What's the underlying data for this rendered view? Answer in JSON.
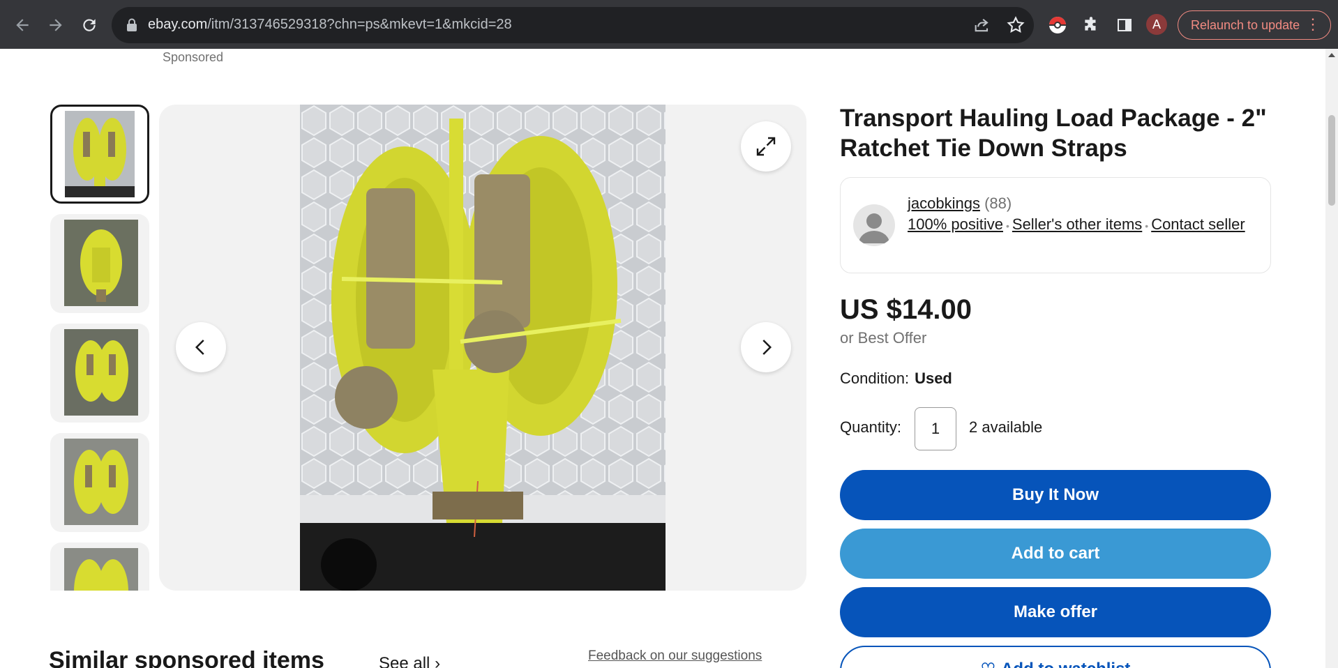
{
  "browser": {
    "url_host": "ebay.com",
    "url_path": "/itm/313746529318?chn=ps&mkevt=1&mkcid=28",
    "profile_initial": "A",
    "relaunch_label": "Relaunch to update",
    "icons": [
      "back-icon",
      "forward-icon",
      "reload-icon",
      "lock-icon",
      "share-icon",
      "star-icon",
      "pokeball-extension-icon",
      "puzzle-icon",
      "side-panel-icon",
      "kebab-menu-icon"
    ]
  },
  "listing": {
    "sponsored_label": "Sponsored",
    "title": "Transport Hauling Load Package - 2\" Ratchet Tie Down Straps",
    "seller": {
      "name": "jacobkings",
      "feedback_count": "(88)",
      "positive": "100% positive",
      "other_items": "Seller's other items",
      "contact": "Contact seller"
    },
    "price": "US $14.00",
    "best_offer": "or Best Offer",
    "condition_label": "Condition:",
    "condition_value": "Used",
    "quantity_label": "Quantity:",
    "quantity_value": "1",
    "available": "2 available",
    "buttons": {
      "buy_now": "Buy It Now",
      "add_to_cart": "Add to cart",
      "make_offer": "Make offer",
      "watchlist": "Add to watchlist"
    }
  },
  "similar": {
    "title": "Similar sponsored items",
    "see_all": "See all",
    "feedback": "Feedback on our suggestions"
  }
}
